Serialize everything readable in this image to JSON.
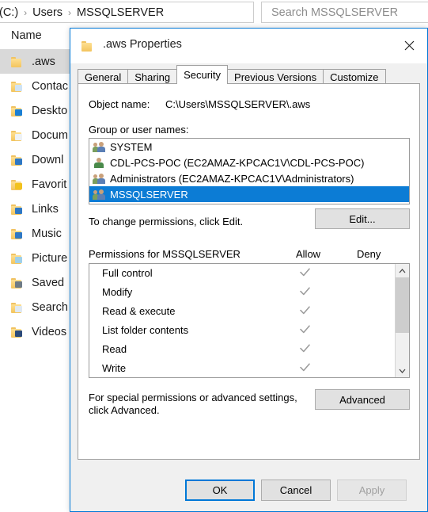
{
  "explorer": {
    "breadcrumb": {
      "items": [
        {
          "label": "(C:)"
        },
        {
          "label": "Users"
        },
        {
          "label": "MSSQLSERVER"
        }
      ],
      "separator": "›",
      "dropdown_icon": "chevron-down-icon",
      "refresh_icon": "refresh-icon"
    },
    "search": {
      "placeholder": "Search MSSQLSERVER",
      "value": ""
    },
    "column_header": "Name",
    "files": [
      {
        "label": ".aws",
        "icon": "folder-icon",
        "selected": true,
        "overlay": "none"
      },
      {
        "label": "Contac",
        "icon": "folder-contacts-icon",
        "selected": false,
        "overlay": "contacts"
      },
      {
        "label": "Deskto",
        "icon": "folder-desktop-icon",
        "selected": false,
        "overlay": "desktop"
      },
      {
        "label": "Docum",
        "icon": "folder-documents-icon",
        "selected": false,
        "overlay": "documents"
      },
      {
        "label": "Downl",
        "icon": "folder-downloads-icon",
        "selected": false,
        "overlay": "downloads"
      },
      {
        "label": "Favorit",
        "icon": "folder-favorites-icon",
        "selected": false,
        "overlay": "favorites"
      },
      {
        "label": "Links",
        "icon": "folder-links-icon",
        "selected": false,
        "overlay": "links"
      },
      {
        "label": "Music",
        "icon": "folder-music-icon",
        "selected": false,
        "overlay": "music"
      },
      {
        "label": "Picture",
        "icon": "folder-pictures-icon",
        "selected": false,
        "overlay": "pictures"
      },
      {
        "label": "Saved",
        "icon": "folder-saved-icon",
        "selected": false,
        "overlay": "saved"
      },
      {
        "label": "Search",
        "icon": "folder-searches-icon",
        "selected": false,
        "overlay": "searches"
      },
      {
        "label": "Videos",
        "icon": "folder-videos-icon",
        "selected": false,
        "overlay": "videos"
      }
    ]
  },
  "dialog": {
    "title": ".aws Properties",
    "title_icon": "folder-icon",
    "close_icon": "close-icon",
    "tabs": [
      {
        "label": "General",
        "active": false
      },
      {
        "label": "Sharing",
        "active": false
      },
      {
        "label": "Security",
        "active": true
      },
      {
        "label": "Previous Versions",
        "active": false
      },
      {
        "label": "Customize",
        "active": false
      }
    ],
    "security": {
      "object_name_label": "Object name:",
      "object_name_value": "C:\\Users\\MSSQLSERVER\\.aws",
      "groups_label": "Group or user names:",
      "groups": [
        {
          "label": "SYSTEM",
          "icon": "group-icon",
          "selected": false
        },
        {
          "label": "CDL-PCS-POC (EC2AMAZ-KPCAC1V\\CDL-PCS-POC)",
          "icon": "user-icon",
          "selected": false
        },
        {
          "label": "Administrators (EC2AMAZ-KPCAC1V\\Administrators)",
          "icon": "group-icon",
          "selected": false
        },
        {
          "label": "MSSQLSERVER",
          "icon": "group-icon",
          "selected": true
        }
      ],
      "edit_note": "To change permissions, click Edit.",
      "edit_button": "Edit...",
      "permissions_label": "Permissions for MSSQLSERVER",
      "allow_column": "Allow",
      "deny_column": "Deny",
      "permissions": [
        {
          "name": "Full control",
          "allow": true,
          "deny": false
        },
        {
          "name": "Modify",
          "allow": true,
          "deny": false
        },
        {
          "name": "Read & execute",
          "allow": true,
          "deny": false
        },
        {
          "name": "List folder contents",
          "allow": true,
          "deny": false
        },
        {
          "name": "Read",
          "allow": true,
          "deny": false
        },
        {
          "name": "Write",
          "allow": true,
          "deny": false
        }
      ],
      "scroll_up_icon": "chevron-up-icon",
      "scroll_down_icon": "chevron-down-icon",
      "advanced_note": "For special permissions or advanced settings, click Advanced.",
      "advanced_button": "Advanced"
    },
    "footer": {
      "ok": "OK",
      "cancel": "Cancel",
      "apply": "Apply",
      "apply_enabled": false
    }
  },
  "colors": {
    "accent": "#0078d7",
    "selection": "#0c7cd5",
    "file_selection": "#d9d9d9",
    "dialog_face": "#f0f0f0",
    "check_gray": "#9a9a9a"
  }
}
